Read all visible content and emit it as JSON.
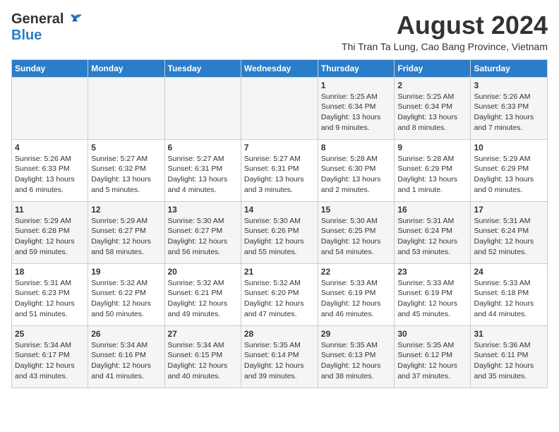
{
  "header": {
    "logo_line1": "General",
    "logo_line2": "Blue",
    "main_title": "August 2024",
    "subtitle": "Thi Tran Ta Lung, Cao Bang Province, Vietnam"
  },
  "days_of_week": [
    "Sunday",
    "Monday",
    "Tuesday",
    "Wednesday",
    "Thursday",
    "Friday",
    "Saturday"
  ],
  "weeks": [
    [
      {
        "day": "",
        "info": ""
      },
      {
        "day": "",
        "info": ""
      },
      {
        "day": "",
        "info": ""
      },
      {
        "day": "",
        "info": ""
      },
      {
        "day": "1",
        "info": "Sunrise: 5:25 AM\nSunset: 6:34 PM\nDaylight: 13 hours\nand 9 minutes."
      },
      {
        "day": "2",
        "info": "Sunrise: 5:25 AM\nSunset: 6:34 PM\nDaylight: 13 hours\nand 8 minutes."
      },
      {
        "day": "3",
        "info": "Sunrise: 5:26 AM\nSunset: 6:33 PM\nDaylight: 13 hours\nand 7 minutes."
      }
    ],
    [
      {
        "day": "4",
        "info": "Sunrise: 5:26 AM\nSunset: 6:33 PM\nDaylight: 13 hours\nand 6 minutes."
      },
      {
        "day": "5",
        "info": "Sunrise: 5:27 AM\nSunset: 6:32 PM\nDaylight: 13 hours\nand 5 minutes."
      },
      {
        "day": "6",
        "info": "Sunrise: 5:27 AM\nSunset: 6:31 PM\nDaylight: 13 hours\nand 4 minutes."
      },
      {
        "day": "7",
        "info": "Sunrise: 5:27 AM\nSunset: 6:31 PM\nDaylight: 13 hours\nand 3 minutes."
      },
      {
        "day": "8",
        "info": "Sunrise: 5:28 AM\nSunset: 6:30 PM\nDaylight: 13 hours\nand 2 minutes."
      },
      {
        "day": "9",
        "info": "Sunrise: 5:28 AM\nSunset: 6:29 PM\nDaylight: 13 hours\nand 1 minute."
      },
      {
        "day": "10",
        "info": "Sunrise: 5:29 AM\nSunset: 6:29 PM\nDaylight: 13 hours\nand 0 minutes."
      }
    ],
    [
      {
        "day": "11",
        "info": "Sunrise: 5:29 AM\nSunset: 6:28 PM\nDaylight: 12 hours\nand 59 minutes."
      },
      {
        "day": "12",
        "info": "Sunrise: 5:29 AM\nSunset: 6:27 PM\nDaylight: 12 hours\nand 58 minutes."
      },
      {
        "day": "13",
        "info": "Sunrise: 5:30 AM\nSunset: 6:27 PM\nDaylight: 12 hours\nand 56 minutes."
      },
      {
        "day": "14",
        "info": "Sunrise: 5:30 AM\nSunset: 6:26 PM\nDaylight: 12 hours\nand 55 minutes."
      },
      {
        "day": "15",
        "info": "Sunrise: 5:30 AM\nSunset: 6:25 PM\nDaylight: 12 hours\nand 54 minutes."
      },
      {
        "day": "16",
        "info": "Sunrise: 5:31 AM\nSunset: 6:24 PM\nDaylight: 12 hours\nand 53 minutes."
      },
      {
        "day": "17",
        "info": "Sunrise: 5:31 AM\nSunset: 6:24 PM\nDaylight: 12 hours\nand 52 minutes."
      }
    ],
    [
      {
        "day": "18",
        "info": "Sunrise: 5:31 AM\nSunset: 6:23 PM\nDaylight: 12 hours\nand 51 minutes."
      },
      {
        "day": "19",
        "info": "Sunrise: 5:32 AM\nSunset: 6:22 PM\nDaylight: 12 hours\nand 50 minutes."
      },
      {
        "day": "20",
        "info": "Sunrise: 5:32 AM\nSunset: 6:21 PM\nDaylight: 12 hours\nand 49 minutes."
      },
      {
        "day": "21",
        "info": "Sunrise: 5:32 AM\nSunset: 6:20 PM\nDaylight: 12 hours\nand 47 minutes."
      },
      {
        "day": "22",
        "info": "Sunrise: 5:33 AM\nSunset: 6:19 PM\nDaylight: 12 hours\nand 46 minutes."
      },
      {
        "day": "23",
        "info": "Sunrise: 5:33 AM\nSunset: 6:19 PM\nDaylight: 12 hours\nand 45 minutes."
      },
      {
        "day": "24",
        "info": "Sunrise: 5:33 AM\nSunset: 6:18 PM\nDaylight: 12 hours\nand 44 minutes."
      }
    ],
    [
      {
        "day": "25",
        "info": "Sunrise: 5:34 AM\nSunset: 6:17 PM\nDaylight: 12 hours\nand 43 minutes."
      },
      {
        "day": "26",
        "info": "Sunrise: 5:34 AM\nSunset: 6:16 PM\nDaylight: 12 hours\nand 41 minutes."
      },
      {
        "day": "27",
        "info": "Sunrise: 5:34 AM\nSunset: 6:15 PM\nDaylight: 12 hours\nand 40 minutes."
      },
      {
        "day": "28",
        "info": "Sunrise: 5:35 AM\nSunset: 6:14 PM\nDaylight: 12 hours\nand 39 minutes."
      },
      {
        "day": "29",
        "info": "Sunrise: 5:35 AM\nSunset: 6:13 PM\nDaylight: 12 hours\nand 38 minutes."
      },
      {
        "day": "30",
        "info": "Sunrise: 5:35 AM\nSunset: 6:12 PM\nDaylight: 12 hours\nand 37 minutes."
      },
      {
        "day": "31",
        "info": "Sunrise: 5:36 AM\nSunset: 6:11 PM\nDaylight: 12 hours\nand 35 minutes."
      }
    ]
  ]
}
